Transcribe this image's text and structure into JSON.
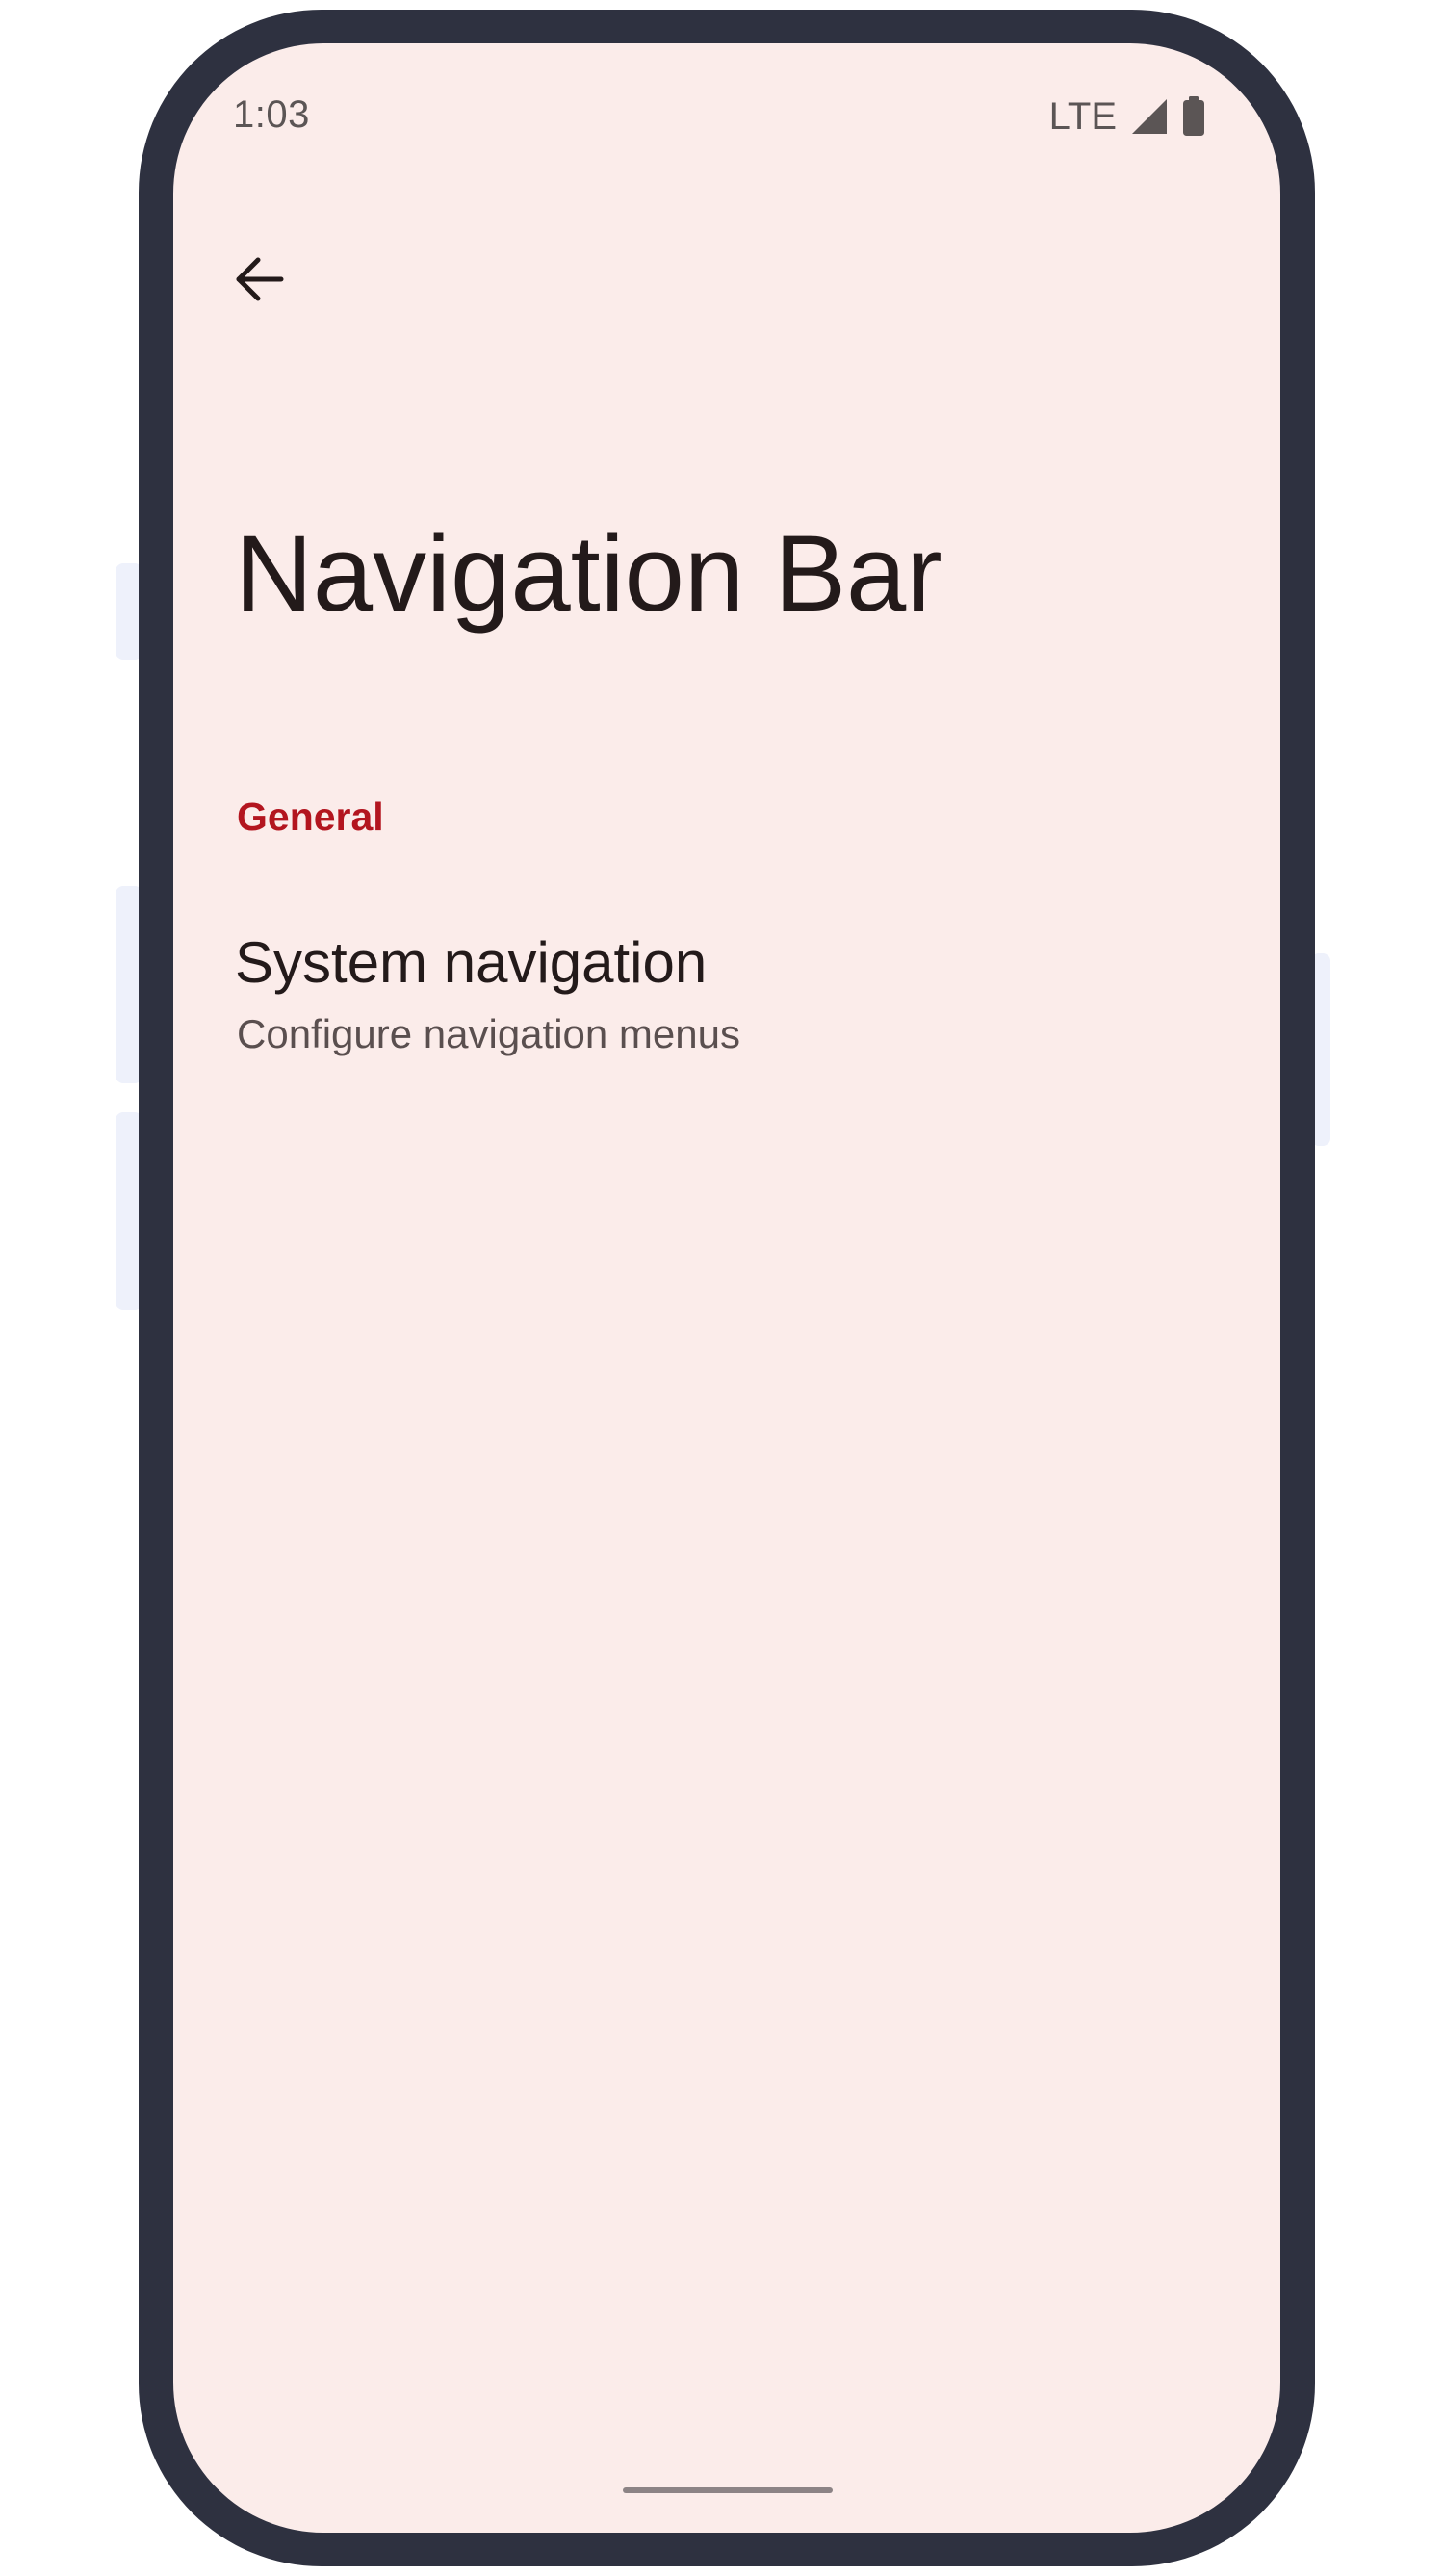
{
  "status_bar": {
    "time": "1:03",
    "network": "LTE",
    "signal_icon": "cellular-signal-icon",
    "battery_icon": "battery-icon"
  },
  "toolbar": {
    "back_icon": "back-arrow-icon"
  },
  "page": {
    "title": "Navigation Bar"
  },
  "sections": [
    {
      "header": "General",
      "items": [
        {
          "title": "System navigation",
          "summary": "Configure navigation menus"
        }
      ]
    }
  ],
  "colors": {
    "background": "#fbecea",
    "accent": "#b3151f",
    "frame": "#2e3140",
    "text_primary": "#231a1a",
    "text_secondary": "#5a4f4f"
  }
}
